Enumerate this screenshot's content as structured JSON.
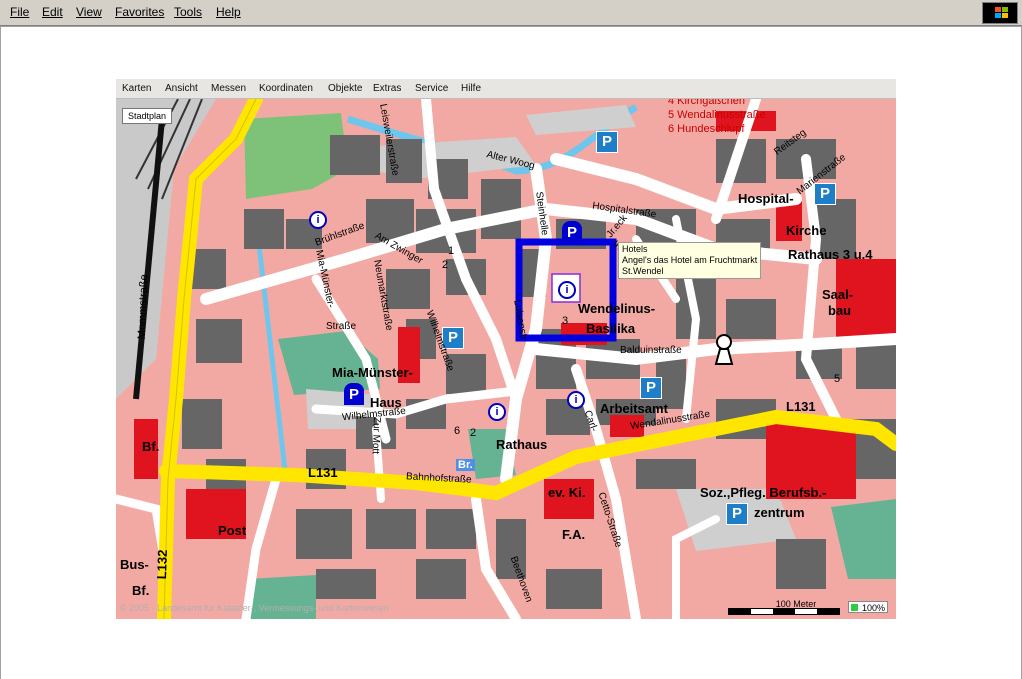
{
  "browser_menu": [
    "File",
    "Edit",
    "View",
    "Favorites",
    "Tools",
    "Help"
  ],
  "app_menu": [
    "Karten",
    "Ansicht",
    "Messen",
    "Koordinaten",
    "Objekte",
    "Extras",
    "Service",
    "Hilfe"
  ],
  "map": {
    "mode_button": "Stadtplan",
    "tooltip": [
      "Hotels",
      "Angel's das Hotel am Fruchtmarkt",
      "St.Wendel"
    ],
    "copyright": "© 2005 - Landesamt für Kataster-, Vermessungs- und Kartenwesen",
    "scale_label": "100 Meter",
    "zoom": "100%",
    "streets": {
      "mommstrasse": "Mommstraße",
      "l132": "L132",
      "l131_left": "L131",
      "l131_right": "L131",
      "bahnhofstrasse": "Bahnhofstraße",
      "wendalinusstrasse": "Wendalinusstraße",
      "bruhlstrasse": "Brühlstraße",
      "leiswellerstrasse": "Leisweilerstraße",
      "alter_woog": "Alter Woog",
      "steinhelle": "Steinhelle",
      "hospitalstrasse": "Hospitalstraße",
      "reitsteg": "Reitsteg",
      "marienstrasse": "Marienstraße",
      "am_zwinger": "Am Zwinger",
      "mia_munster": "Mia-Münster-",
      "strasse": "Straße",
      "neumarkstrasse": "Neumarktstraße",
      "wilhelmstrasse1": "Wilhelmstraße",
      "wilhelmstrasse2": "Wilhelmstraße",
      "zur_mott": "Zur Mott",
      "luisenstrasse": "Luisenstr",
      "balduinstrasse": "Balduinstraße",
      "carl": "Carl-",
      "cettostrasse": "Cetto-Straße",
      "beethoven": "Beethoven",
      "im_gang": "Im Gang",
      "j_eck": "Jr.eck"
    },
    "labels": {
      "hospital": "Hospital-",
      "kirche": "Kirche",
      "rathaus34": "Rathaus 3 u.4",
      "saal": "Saal-",
      "bau": "bau",
      "wendelinus": "Wendelinus-",
      "basilika": "Basilika",
      "mia_munster_haus1": "Mia-Münster-",
      "mia_munster_haus2": "Haus",
      "arbeitsamt": "Arbeitsamt",
      "rathaus": "Rathaus",
      "br": "Br.",
      "ev_ki": "ev. Ki.",
      "fa": "F.A.",
      "soz": "Soz.,Pfleg. Berufsb.-",
      "zentrum": "zentrum",
      "bf": "Bf.",
      "post": "Post",
      "bus": "Bus-",
      "bf2": "Bf.",
      "gassen": [
        "4 Kirchgäßchen",
        "5 Wendalinusstraße",
        "6 Hundeschlupf"
      ],
      "n1": "1",
      "n2": "2",
      "n3": "3",
      "n5": "5",
      "n6": "6",
      "n2b": "2"
    },
    "icons": {
      "parking": "P",
      "info": "i"
    },
    "colors": {
      "block": "#f3a9a3",
      "building": "#666666",
      "road": "#ffffff",
      "main_road": "#ffe600",
      "public_building": "#e0141e",
      "green": "#66b394",
      "park": "#7ec27a",
      "water": "#6fc6ec",
      "parking": "#1e7fc8",
      "selection": "#0000e0"
    }
  }
}
